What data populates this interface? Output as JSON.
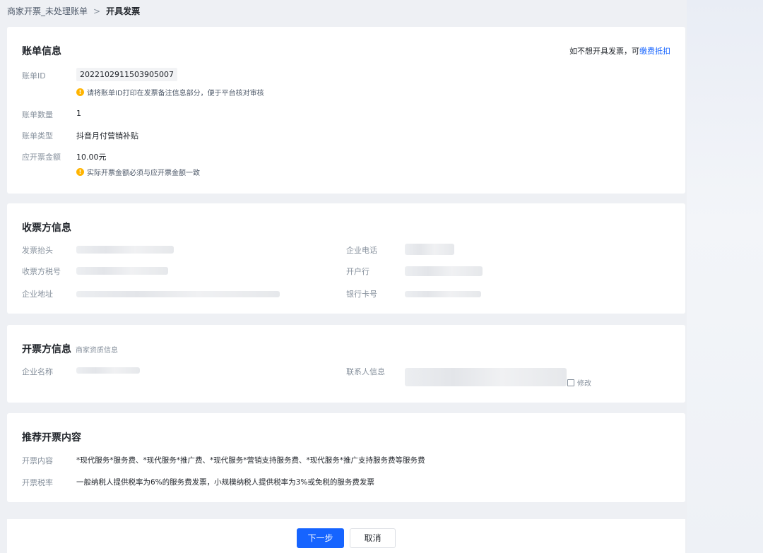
{
  "breadcrumb": {
    "parent": "商家开票_未处理账单",
    "separator": ">",
    "current": "开具发票"
  },
  "bill_info": {
    "title": "账单信息",
    "opt_out_prefix": "如不想开具发票，可",
    "opt_out_link": "缴费抵扣",
    "fields": {
      "bill_id_label": "账单ID",
      "bill_id_value": "2022102911503905007",
      "bill_id_tip": "请将账单ID打印在发票备注信息部分，便于平台核对审核",
      "count_label": "账单数量",
      "count_value": "1",
      "type_label": "账单类型",
      "type_value": "抖音月付营销补贴",
      "amount_label": "应开票金额",
      "amount_value": "10.00元",
      "amount_tip": "实际开票金额必须与应开票金额一致"
    }
  },
  "receiver_info": {
    "title": "收票方信息",
    "header_label": "发票抬头",
    "phone_label": "企业电话",
    "tax_no_label": "收票方税号",
    "bank_label": "开户行",
    "address_label": "企业地址",
    "card_no_label": "银行卡号"
  },
  "issuer_info": {
    "title": "开票方信息",
    "subtitle": "商家资质信息",
    "company_label": "企业名称",
    "contact_label": "联系人信息",
    "edit_label": "修改"
  },
  "recommend": {
    "title": "推荐开票内容",
    "content_label": "开票内容",
    "content_value": "*现代服务*服务费、*现代服务*推广费、*现代服务*营销支持服务费、*现代服务*推广支持服务费等服务费",
    "tax_label": "开票税率",
    "tax_value": "一般纳税人提供税率为6%的服务费发票，小规模纳税人提供税率为3%或免税的服务费发票"
  },
  "footer": {
    "next_label": "下一步",
    "cancel_label": "取消"
  },
  "colors": {
    "primary": "#1664ff",
    "warning": "#ffb400",
    "label": "#86909c",
    "text": "#1f2329"
  }
}
